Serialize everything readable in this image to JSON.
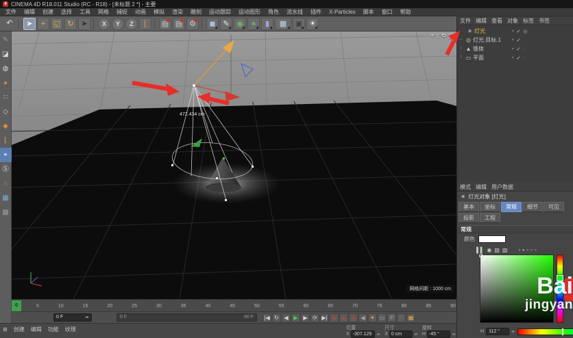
{
  "window": {
    "title": "CINEMA 4D R18.011 Studio (RC - R18) - [未标题 2 *] - 主要",
    "logo_letter": "4"
  },
  "menubar": {
    "items": [
      "文件",
      "编辑",
      "创建",
      "选择",
      "工具",
      "网格",
      "捕捉",
      "动画",
      "模拟",
      "渲染",
      "雕刻",
      "运动跟踪",
      "运动图形",
      "角色",
      "流水线",
      "插件",
      "X-Particles",
      "脚本",
      "窗口",
      "帮助"
    ]
  },
  "toolbar": {
    "icons": [
      {
        "name": "undo-icon",
        "g": "↶",
        "fg": "#e2e2e2"
      },
      {
        "name": "toolbar-separator",
        "g": "",
        "k": "sep"
      },
      {
        "name": "live-selection-icon",
        "g": "➤",
        "fg": "#f5f5f5",
        "k": "tile sel"
      },
      {
        "name": "move-icon",
        "g": "+",
        "fg": "#e3b84d",
        "k": "tile"
      },
      {
        "name": "scale-icon",
        "g": "◱",
        "fg": "#e3b84d",
        "k": "tile"
      },
      {
        "name": "rotate-icon",
        "g": "↻",
        "fg": "#e3b84d",
        "k": "tile"
      },
      {
        "name": "last-tool-icon",
        "g": "➤",
        "fg": "#2f2f2f",
        "k": "tile"
      },
      {
        "name": "toolbar-separator",
        "g": "",
        "k": "sep"
      },
      {
        "name": "x-axis-lock-icon",
        "g": "X",
        "fg": "#e0e0e0",
        "k": "tile round"
      },
      {
        "name": "y-axis-lock-icon",
        "g": "Y",
        "fg": "#e0e0e0",
        "k": "tile round"
      },
      {
        "name": "z-axis-lock-icon",
        "g": "Z",
        "fg": "#e0e0e0",
        "k": "tile round"
      },
      {
        "name": "coord-system-icon",
        "g": "⌊",
        "fg": "#e3a43d",
        "k": "tile"
      },
      {
        "name": "toolbar-separator",
        "g": "",
        "k": "sep"
      },
      {
        "name": "render-view-icon",
        "g": "▤",
        "fg": "#c9c9c9",
        "k": "tile red-dot"
      },
      {
        "name": "render-picture-icon",
        "g": "▤",
        "fg": "#c9c9c9",
        "k": "tile red-dot"
      },
      {
        "name": "render-settings-icon",
        "g": "⚙",
        "fg": "#c9c9c9",
        "k": "tile red-dot"
      },
      {
        "name": "toolbar-separator",
        "g": "",
        "k": "sep"
      },
      {
        "name": "cube-primitive-icon",
        "g": "◼",
        "fg": "#9fc0dc",
        "k": "tile fly"
      },
      {
        "name": "pen-spline-icon",
        "g": "✎",
        "fg": "#e8e8e8",
        "k": "tile fly"
      },
      {
        "name": "subdivision-surface-icon",
        "g": "◉",
        "fg": "#6cbd5a",
        "k": "tile fly"
      },
      {
        "name": "array-icon",
        "g": "∗",
        "fg": "#6cbd5a",
        "k": "tile fly"
      },
      {
        "name": "deformer-icon",
        "g": "▮",
        "fg": "#a99fe0",
        "k": "tile fly"
      },
      {
        "name": "floor-sky-icon",
        "g": "▦",
        "fg": "#bcd7ee",
        "k": "tile fly wide"
      },
      {
        "name": "camera-icon",
        "g": "▣",
        "fg": "#3c3c3c",
        "k": "tile fly"
      },
      {
        "name": "light-tool-icon",
        "g": "☀",
        "fg": "#f2f2f2",
        "k": "tile fly"
      }
    ]
  },
  "sidebar": {
    "icons": [
      {
        "name": "modeling-pen-icon",
        "g": "✎",
        "fg": "#9a9a9a"
      },
      {
        "name": "model-mode-icon",
        "g": "◪",
        "fg": "#d8d8d8"
      },
      {
        "name": "texture-mode-icon",
        "g": "◍",
        "fg": "#d8d8d8"
      },
      {
        "name": "workplane-mode-icon",
        "g": "●",
        "fg": "#cd8a33"
      },
      {
        "name": "points-mode-icon",
        "g": "∷",
        "fg": "#d8d8d8"
      },
      {
        "name": "edges-mode-icon",
        "g": "◇",
        "fg": "#d8d8d8"
      },
      {
        "name": "polygons-mode-icon",
        "g": "◆",
        "fg": "#d98c3a"
      },
      {
        "name": "axis-mode-icon",
        "g": "⌊",
        "fg": "#e0b050"
      },
      {
        "name": "snap-icon",
        "g": "⌖",
        "fg": "#ffffff",
        "k": "hl"
      },
      {
        "name": "snap-s-icon",
        "g": "Ⓢ",
        "fg": "#e0e0e0"
      },
      {
        "name": "magnet-icon",
        "g": "∩",
        "fg": "#d98c3a"
      },
      {
        "name": "workplane-grid-icon",
        "g": "▦",
        "fg": "#7fa9d9"
      },
      {
        "name": "workplane-lock-icon",
        "g": "▩",
        "fg": "#9a9a9a"
      }
    ]
  },
  "viewport": {
    "distance_label": "472.434 cm",
    "grid_spacing_label": "网格间距 : 1000 cm",
    "nav_icons": [
      {
        "name": "pan-view-icon",
        "g": "+"
      },
      {
        "name": "zoom-view-icon",
        "g": "↕"
      },
      {
        "name": "rotate-view-icon",
        "g": "↻"
      },
      {
        "name": "toggle-view-icon",
        "g": "◱"
      }
    ]
  },
  "timeline": {
    "playhead": "0",
    "ticks": [
      "5",
      "10",
      "15",
      "20",
      "25",
      "30",
      "35",
      "40",
      "45",
      "50",
      "55",
      "60",
      "65",
      "70",
      "75",
      "80",
      "85",
      "90"
    ],
    "current_frame": "0 F",
    "range_start": "0 F",
    "range_end": "90 F",
    "buttons": [
      {
        "name": "goto-start-button",
        "g": "|◀"
      },
      {
        "name": "play-mode-button",
        "g": "↻"
      },
      {
        "name": "prev-frame-button",
        "g": "◀"
      },
      {
        "name": "play-button",
        "g": "▶",
        "k": "play"
      },
      {
        "name": "next-frame-button",
        "g": "▶"
      },
      {
        "name": "loop-button",
        "g": "⟳"
      },
      {
        "name": "goto-end-button",
        "g": "▶|"
      },
      {
        "name": "record-keyframe-button",
        "g": "●",
        "k": "rec"
      },
      {
        "name": "autokey-button",
        "g": "●",
        "k": "rec"
      },
      {
        "name": "keyframe-selection-button",
        "g": "●",
        "k": "rec"
      },
      {
        "name": "prev-key-button",
        "g": "◀",
        "k": "dim"
      },
      {
        "name": "key-mode-button",
        "g": "✦",
        "k": "key"
      },
      {
        "name": "frame-range-button",
        "g": "▭",
        "k": "dim"
      },
      {
        "name": "powerslider-button",
        "g": "Ⓟ",
        "k": "dim"
      },
      {
        "name": "snap-frames-button",
        "g": "∷",
        "k": "dim"
      },
      {
        "name": "film-options-button",
        "g": "▦",
        "k": "film"
      }
    ]
  },
  "materials": {
    "menu": [
      "创建",
      "编辑",
      "功能",
      "纹理"
    ]
  },
  "coordinates": {
    "position": {
      "header": "位置",
      "axis": "X",
      "value": "-307.129 cm"
    },
    "size": {
      "header": "尺寸",
      "axis": "X",
      "value": "0 cm"
    },
    "rotation": {
      "header": "旋转",
      "axis": "H",
      "value": "-45 °"
    }
  },
  "object_manager": {
    "menu": [
      "文件",
      "编辑",
      "查看",
      "对象",
      "标签",
      "书签"
    ],
    "objects": [
      {
        "name": "灯光",
        "glyph": "☀",
        "selected": true
      },
      {
        "name": "灯光.目标.1",
        "glyph": "◎",
        "selected": false
      },
      {
        "name": "锥体",
        "glyph": "▲",
        "selected": false
      },
      {
        "name": "平面",
        "glyph": "▭",
        "selected": false
      }
    ]
  },
  "attributes": {
    "menu": [
      "模式",
      "编辑",
      "用户数据"
    ],
    "title": "灯光对象 [灯光]",
    "tabs": [
      "基本",
      "坐标",
      "常规",
      "细节",
      "可见",
      "投影"
    ],
    "tabs_row2": "工程",
    "active_tab": "常规",
    "section": "常规",
    "color_label": "颜色",
    "picker_icons_left": [
      {
        "name": "compare-colors-icon",
        "g": "▌▌"
      },
      {
        "name": "color-wheel-icon",
        "g": "◉"
      },
      {
        "name": "color-spectrum-icon",
        "g": "▨"
      },
      {
        "name": "color-picture-icon",
        "g": "▧"
      }
    ],
    "picker_icons_right": [
      {
        "name": "swatch-mode-icon",
        "g": "▫"
      },
      {
        "name": "rgb-mode-icon",
        "g": "▪"
      },
      {
        "name": "hsv-mode-icon",
        "g": "▫"
      },
      {
        "name": "kelvin-mode-icon",
        "g": "▫"
      },
      {
        "name": "mixer-mode-icon",
        "g": "▫"
      }
    ],
    "hue_label": "H",
    "hue_value": "112 °"
  },
  "icons": {
    "panel_grid": "⊞",
    "expander_minus": "−",
    "branch": "└",
    "layer_square": "▪",
    "check": "✓",
    "dots": "∶",
    "target": "◎",
    "spinner_up_down": "◂▸"
  },
  "watermark": {
    "line1": "Bai",
    "line2": "jingyan"
  },
  "colors": {
    "accent_blue": "#6687c2",
    "playhead_green": "#3fa14e",
    "annotation_red": "#e62e2a",
    "selected_yellow": "#eec63f",
    "color_swatch": "#ffffff",
    "hue_degrees": 112
  }
}
